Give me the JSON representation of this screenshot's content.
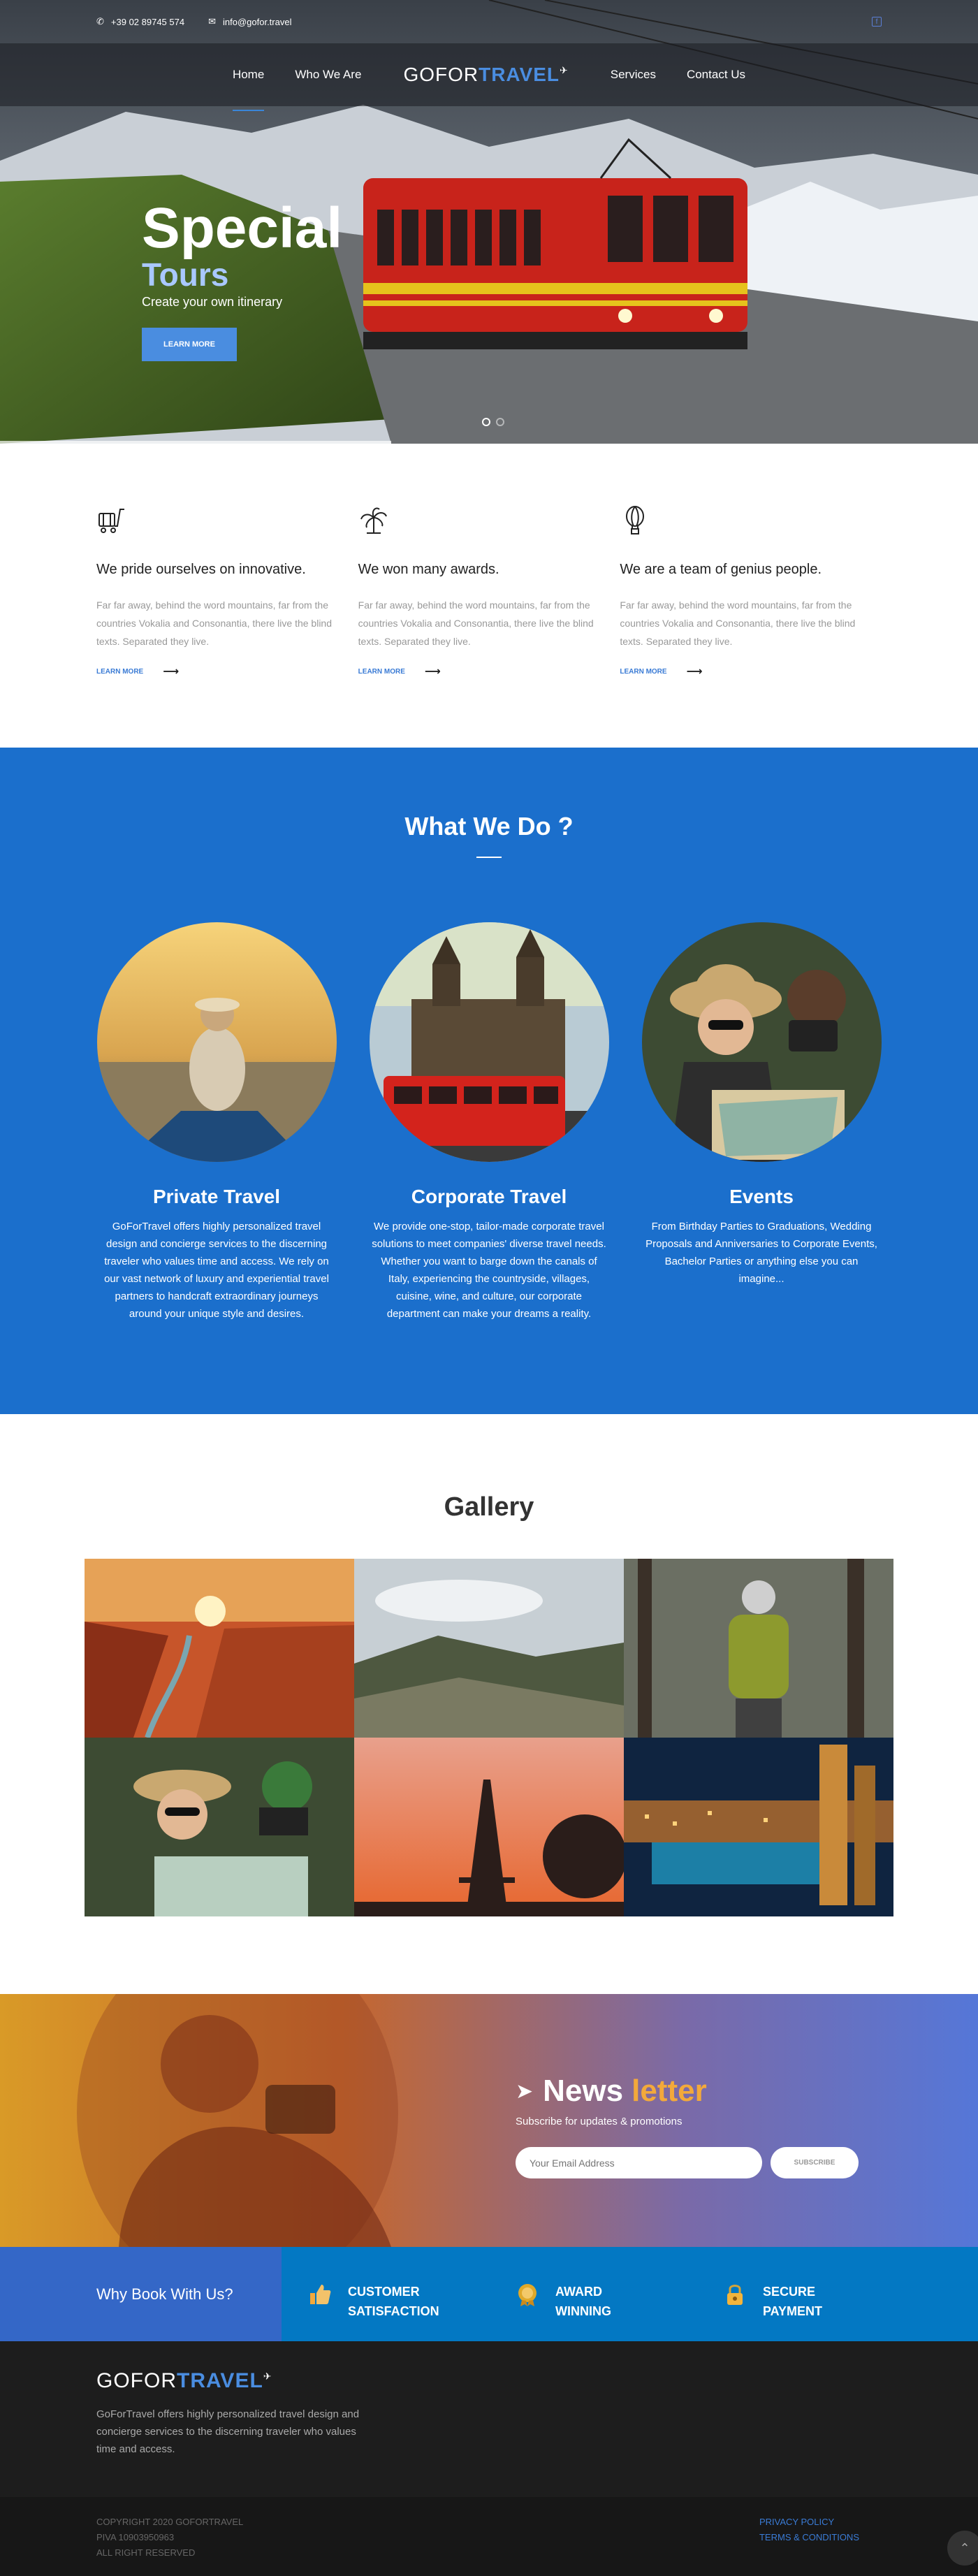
{
  "topbar": {
    "phone": "+39 02 89745 574",
    "email": "info@gofor.travel"
  },
  "nav": {
    "items": [
      "Home",
      "Who We Are",
      "Services",
      "Contact Us"
    ],
    "logo_a": "GOFOR",
    "logo_b": "TRAVEL"
  },
  "hero": {
    "title": "Special",
    "subtitle": "Tours",
    "tagline": "Create your own itinerary",
    "button": "LEARN MORE"
  },
  "features": [
    {
      "icon": "luggage-cart-icon",
      "title": "We pride ourselves on innovative.",
      "text": "Far far away, behind the word mountains, far from the countries Vokalia and Consonantia, there live the blind texts. Separated they live.",
      "link": "LEARN MORE"
    },
    {
      "icon": "palm-tree-icon",
      "title": "We won many awards.",
      "text": "Far far away, behind the word mountains, far from the countries Vokalia and Consonantia, there live the blind texts. Separated they live.",
      "link": "LEARN MORE"
    },
    {
      "icon": "hot-air-balloon-icon",
      "title": "We are a team of genius people.",
      "text": "Far far away, behind the word mountains, far from the countries Vokalia and Consonantia, there live the blind texts. Separated they live.",
      "link": "LEARN MORE"
    }
  ],
  "what": {
    "title": "What We Do ?",
    "items": [
      {
        "title": "Private Travel",
        "text": "GoForTravel offers highly personalized travel design and concierge services to the discerning traveler who values time and access. We rely on our vast network of luxury and experiential travel partners to handcraft extraordinary journeys around your unique style and desires."
      },
      {
        "title": "Corporate Travel",
        "text": "We provide one-stop, tailor-made corporate travel solutions to meet companies' diverse travel needs. Whether you want to barge down the canals of Italy, experiencing the countryside, villages, cuisine, wine, and culture, our corporate department can make your dreams a reality."
      },
      {
        "title": "Events",
        "text": "From Birthday Parties to Graduations, Wedding Proposals and Anniversaries to Corporate Events, Bachelor Parties or anything else you can imagine..."
      }
    ]
  },
  "gallery": {
    "title": "Gallery"
  },
  "newsletter": {
    "title_a": "News",
    "title_b": "letter",
    "sub": "Subscribe for updates & promotions",
    "placeholder": "Your Email Address",
    "button": "SUBSCRIBE"
  },
  "why": {
    "title": "Why Book With Us?",
    "items": [
      {
        "icon": "thumbs-up-icon",
        "line1": "CUSTOMER",
        "line2": "SATISFACTION"
      },
      {
        "icon": "award-medal-icon",
        "line1": "AWARD",
        "line2": "WINNING"
      },
      {
        "icon": "padlock-icon",
        "line1": "SECURE",
        "line2": "PAYMENT"
      }
    ]
  },
  "footer": {
    "logo_a": "GOFOR",
    "logo_b": "TRAVEL",
    "text": "GoForTravel offers highly personalized travel design and concierge services to the discerning traveler who values time and access."
  },
  "bottom": {
    "copyright": "COPYRIGHT 2020 GOFORTRAVEL",
    "piva": "PIVA 10903950963",
    "rights": "ALL RIGHT RESERVED",
    "privacy": "PRIVACY POLICY",
    "terms": "TERMS & CONDITIONS"
  },
  "colors": {
    "primary": "#1b6fcc",
    "accent": "#f3a93b",
    "link": "#3a7bd5"
  }
}
